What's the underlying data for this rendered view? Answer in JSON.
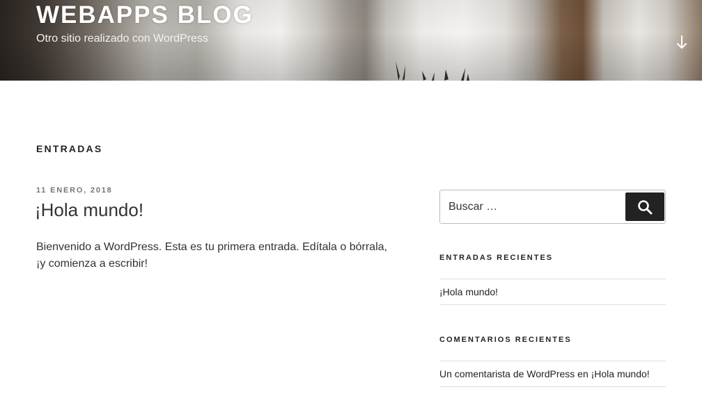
{
  "header": {
    "site_title": "WEBAPPS BLOG",
    "site_description": "Otro sitio realizado con WordPress",
    "scroll_icon": "arrow-down-icon"
  },
  "main": {
    "page_title": "ENTRADAS",
    "post": {
      "date": "11 ENERO, 2018",
      "title": "¡Hola mundo!",
      "excerpt_line1": "Bienvenido a WordPress. Esta es tu primera entrada. Edítala o bórrala,",
      "excerpt_line2": "¡y comienza a escribir!"
    }
  },
  "sidebar": {
    "search": {
      "placeholder": "Buscar …",
      "button_icon": "search-icon"
    },
    "recent_posts": {
      "title": "ENTRADAS RECIENTES",
      "items": [
        {
          "label": "¡Hola mundo!"
        }
      ]
    },
    "recent_comments": {
      "title": "COMENTARIOS RECIENTES",
      "items": [
        {
          "author": "Un comentarista de WordPress",
          "connector": " en ",
          "post": "¡Hola mundo!"
        }
      ]
    }
  },
  "colors": {
    "title_text": "#222222",
    "meta_text": "#767676",
    "search_button": "#222222",
    "divider": "#dddddd"
  }
}
